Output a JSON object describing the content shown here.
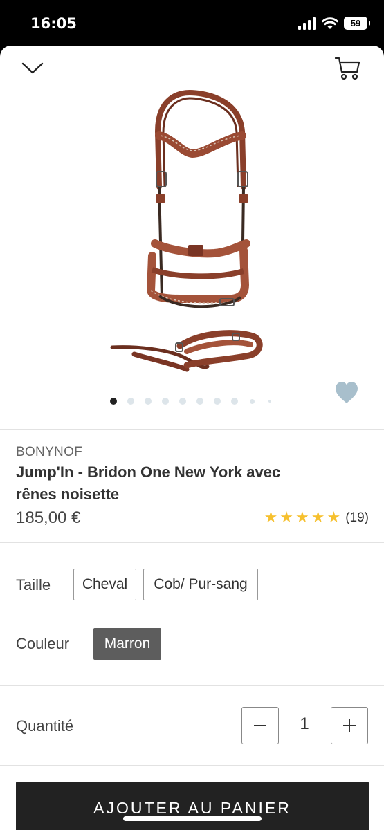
{
  "status_bar": {
    "time": "16:05",
    "battery": "59",
    "icons": [
      "signal-icon",
      "wifi-icon",
      "battery-icon"
    ]
  },
  "header": {
    "close_icon": "chevron-down-icon",
    "cart_icon": "cart-icon"
  },
  "gallery": {
    "image_count": 10,
    "active_index": 0,
    "favorite_icon": "heart-icon"
  },
  "product": {
    "brand": "BONYNOF",
    "title": "Jump'In - Bridon One New York avec rênes noisette",
    "price": "185,00 €",
    "rating": 5,
    "stars": "★★★★★",
    "review_count": "(19)"
  },
  "options": {
    "size_label": "Taille",
    "sizes": [
      "Cheval",
      "Cob/ Pur-sang"
    ],
    "color_label": "Couleur",
    "colors": [
      "Marron"
    ],
    "selected_color": "Marron"
  },
  "quantity": {
    "label": "Quantité",
    "value": "1",
    "minus_icon": "minus-icon",
    "plus_icon": "plus-icon"
  },
  "cta": {
    "add_to_cart": "AJOUTER AU PANIER"
  },
  "colors": {
    "accent_dark": "#222222",
    "star": "#f6c02e",
    "selected_chip": "#5d5d5d",
    "heart": "#a8bfcc"
  }
}
